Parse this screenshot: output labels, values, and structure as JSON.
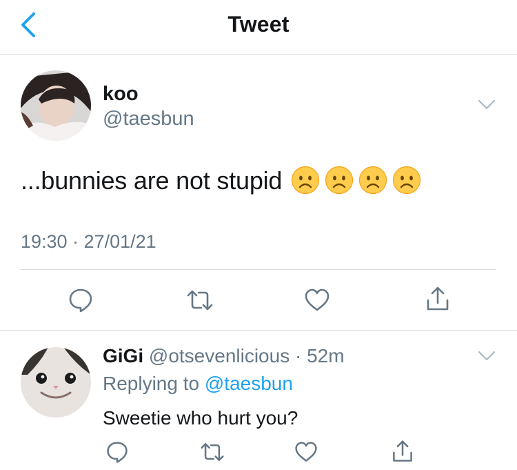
{
  "header": {
    "title": "Tweet"
  },
  "tweet": {
    "author_name": "koo",
    "author_handle": "@taesbun",
    "text": "...bunnies are not stupid",
    "emojis": [
      "frowning-face",
      "frowning-face",
      "frowning-face",
      "frowning-face"
    ],
    "timestamp": "19:30 · 27/01/21"
  },
  "reply": {
    "author_name": "GiGi",
    "author_handle": "@otsevenlicious",
    "meta_sep": " · ",
    "age": "52m",
    "replying_prefix": "Replying to ",
    "replying_to": "@taesbun",
    "text": "Sweetie who hurt you?"
  },
  "colors": {
    "accent": "#1da1f2",
    "secondary_text": "#657786",
    "divider": "#d9dde0",
    "icon_gray": "#657786"
  }
}
